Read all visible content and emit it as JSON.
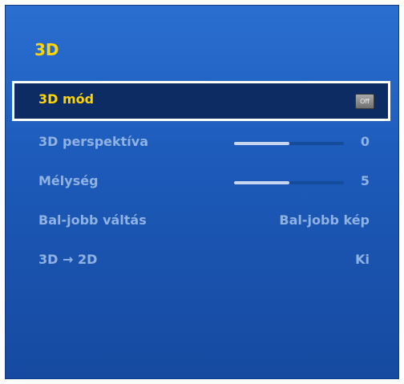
{
  "panel": {
    "title": "3D"
  },
  "menu": {
    "items": [
      {
        "label": "3D mód",
        "toggle": "Off",
        "selected": true
      },
      {
        "label": "3D perspektíva",
        "value": "0",
        "slider_level": 0.5
      },
      {
        "label": "Mélység",
        "value": "5",
        "slider_level": 0.5
      },
      {
        "label": "Bal-jobb váltás",
        "value": "Bal-jobb kép"
      },
      {
        "label": "3D → 2D",
        "value": "Ki"
      }
    ]
  },
  "colors": {
    "highlight_text": "#ffd400",
    "dim_text": "#8fb2e3",
    "panel_blue": "#1c59b8",
    "selection_bg": "#0d2c63"
  }
}
